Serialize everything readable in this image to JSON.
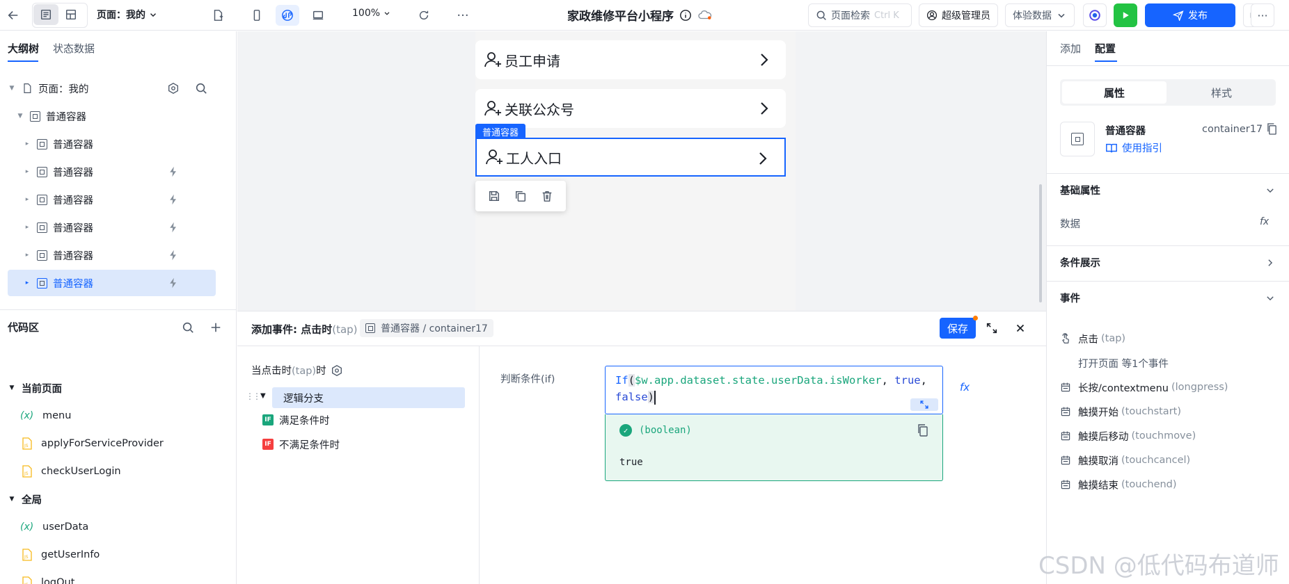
{
  "topbar": {
    "page_selector": "页面：我的",
    "zoom": "100%",
    "app_title": "家政维修平台小程序",
    "search_placeholder": "页面检索",
    "search_shortcut": "Ctrl K",
    "admin": "超级管理员",
    "dataset": "体验数据",
    "publish": "发布"
  },
  "left": {
    "tabs": [
      "大纲树",
      "状态数据"
    ],
    "tree": {
      "root": "页面：我的",
      "container": "普通容器",
      "children": [
        "普通容器",
        "普通容器",
        "普通容器",
        "普通容器",
        "普通容器",
        "普通容器"
      ]
    },
    "code": {
      "title": "代码区",
      "current_page": "当前页面",
      "current_items": [
        {
          "type": "var",
          "label": "menu"
        },
        {
          "type": "js",
          "label": "applyForServiceProvider"
        },
        {
          "type": "js",
          "label": "checkUserLogin"
        }
      ],
      "global": "全局",
      "global_items": [
        {
          "type": "var",
          "label": "userData"
        },
        {
          "type": "js",
          "label": "getUserInfo"
        },
        {
          "type": "js",
          "label": "logOut"
        }
      ]
    }
  },
  "canvas": {
    "cards": [
      "员工申请",
      "关联公众号",
      "工人入口"
    ],
    "selected_label": "普通容器"
  },
  "event": {
    "title": "添加事件: 点击时",
    "title_sub": "(tap)",
    "chip": "普通容器 / container17",
    "save": "保存",
    "trigger": "当点击时",
    "trigger_sub": "(tap)",
    "trigger_suffix": "时",
    "branch": "逻辑分支",
    "cond_true": "满足条件时",
    "cond_false": "不满足条件时",
    "if_badge": "IF",
    "cond_label": "判断条件(if)",
    "code_fn": "If",
    "code_path": "$w.app.dataset.state.userData.isWorker",
    "code_true": "true",
    "code_false": "false",
    "result_type": "(boolean)",
    "result_value": "true",
    "fx": "fx"
  },
  "right": {
    "tabs": [
      "添加",
      "配置"
    ],
    "segments": [
      "属性",
      "样式"
    ],
    "component_name": "普通容器",
    "component_id": "container17",
    "guide": "使用指引",
    "basic_props": "基础属性",
    "data_label": "数据",
    "cond_display": "条件展示",
    "events_title": "事件",
    "events": [
      {
        "label": "点击",
        "sub": "(tap)"
      },
      {
        "label": "长按/contextmenu",
        "sub": "(longpress)"
      },
      {
        "label": "触摸开始",
        "sub": "(touchstart)"
      },
      {
        "label": "触摸后移动",
        "sub": "(touchmove)"
      },
      {
        "label": "触摸取消",
        "sub": "(touchcancel)"
      },
      {
        "label": "触摸结束",
        "sub": "(touchend)"
      }
    ],
    "tap_note": "打开页面 等1个事件"
  },
  "watermark": "CSDN @低代码布道师",
  "colors": {
    "accent": "#1664ff",
    "success": "#1aa67c",
    "selected_bg": "#dce8fc"
  }
}
